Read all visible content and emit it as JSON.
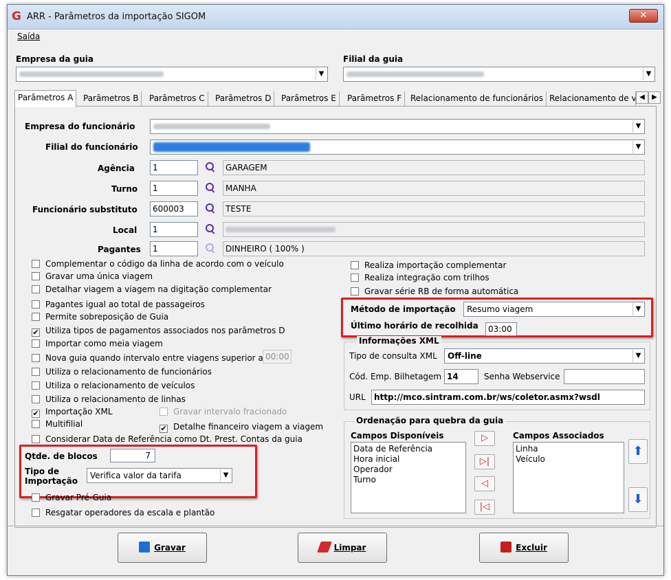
{
  "window": {
    "title": "ARR - Parâmetros da importação  SIGOM",
    "logo": "G",
    "close_icon": "close-icon"
  },
  "menu": {
    "items": [
      "Saída"
    ]
  },
  "empresa_guia": {
    "label": "Empresa  da guia"
  },
  "filial_guia": {
    "label": "Filial  da guia"
  },
  "tabs": [
    "Parâmetros A",
    "Parâmetros B",
    "Parâmetros C",
    "Parâmetros D",
    "Parâmetros E",
    "Parâmetros F",
    "Relacionamento de funcionários",
    "Relacionamento de v"
  ],
  "form": {
    "empresa_funcionario": {
      "label": "Empresa do funcionário"
    },
    "filial_funcionario": {
      "label": "Filial do funcionário"
    },
    "agencia": {
      "label": "Agência",
      "code": "1",
      "desc": "GARAGEM"
    },
    "turno": {
      "label": "Turno",
      "code": "1",
      "desc": "MANHA"
    },
    "funcionario_substituto": {
      "label": "Funcionário substituto",
      "code": "600003",
      "desc": "TESTE"
    },
    "local": {
      "label": "Local",
      "code": "1"
    },
    "pagantes": {
      "label": "Pagantes",
      "code": "1",
      "desc": "DINHEIRO ( 100% )"
    }
  },
  "left_checks": [
    {
      "label": "Complementar o  código da linha de acordo com o veículo",
      "checked": false
    },
    {
      "label": "Gravar uma única viagem",
      "checked": false
    },
    {
      "label": "Detalhar viagem a viagem na digitação complementar",
      "checked": false
    },
    {
      "label": "Pagantes igual ao total de passageiros",
      "checked": false
    },
    {
      "label": "Permite sobreposição de Guia",
      "checked": false
    },
    {
      "label": "Utiliza tipos de pagamentos associados nos parâmetros D",
      "checked": true
    },
    {
      "label": "Importar como meia viagem",
      "checked": false
    },
    {
      "label": "Nova guia quando intervalo entre viagens superior a",
      "checked": false
    },
    {
      "label": "Utiliza o relacionamento de funcionários",
      "checked": false
    },
    {
      "label": "Utiliza o relacionamento de veículos",
      "checked": false
    },
    {
      "label": "Utiliza o relacionamento de linhas",
      "checked": false
    },
    {
      "label": "Importação XML",
      "checked": true
    },
    {
      "label": "Multifilial",
      "checked": false
    },
    {
      "label": "Considerar Data de Referência como Dt. Prest. Contas da guia",
      "checked": false
    }
  ],
  "intervalo_value": "00:00",
  "gravar_intervalo": {
    "label": "Gravar intervalo fracionado",
    "checked": false
  },
  "detalhe_financeiro": {
    "label": "Detalhe financeiro viagem a viagem",
    "checked": true
  },
  "blocos": {
    "label": "Qtde. de blocos",
    "value": "7"
  },
  "tipo_importacao": {
    "label1": "Tipo de",
    "label2": "Importação",
    "value": "Verifica valor da tarifa"
  },
  "bottom_checks": [
    {
      "label": "Gravar Pré-Guia",
      "checked": false
    },
    {
      "label": "Resgatar operadores da escala e plantão",
      "checked": false
    }
  ],
  "right_checks": [
    {
      "label": "Realiza importação complementar",
      "checked": false
    },
    {
      "label": "Realiza integração com trilhos",
      "checked": false
    },
    {
      "label": "Gravar série RB de forma automática",
      "checked": false
    }
  ],
  "metodo": {
    "label": "Método de importação",
    "value": "Resumo viagem"
  },
  "ultimo_horario": {
    "label": "Último horário de recolhida",
    "value": "03:00"
  },
  "xml": {
    "title": "Informações XML",
    "tipo_label": "Tipo de consulta XML",
    "tipo_value": "Off-line",
    "cod_label": "Cód. Emp. Bilhetagem",
    "cod_value": "14",
    "senha_label": "Senha Webservice",
    "senha_value": "",
    "url_label": "URL",
    "url_value": "http://mco.sintram.com.br/ws/coletor.asmx?wsdl"
  },
  "ordenacao": {
    "title": "Ordenação para quebra da guia",
    "disponiveis_label": "Campos Disponíveis",
    "disponiveis": [
      "Data de Referência",
      "Hora inicial",
      "Operador",
      "Turno"
    ],
    "associados_label": "Campos Associados",
    "associados": [
      "Linha",
      "Veículo"
    ]
  },
  "buttons": {
    "gravar": "Gravar",
    "limpar": "Limpar",
    "excluir": "Excluir"
  },
  "colors": {
    "highlight_red": "#dd1e1e",
    "accent_blue": "#1c5fd4",
    "search_purple": "#5b2aa8"
  }
}
